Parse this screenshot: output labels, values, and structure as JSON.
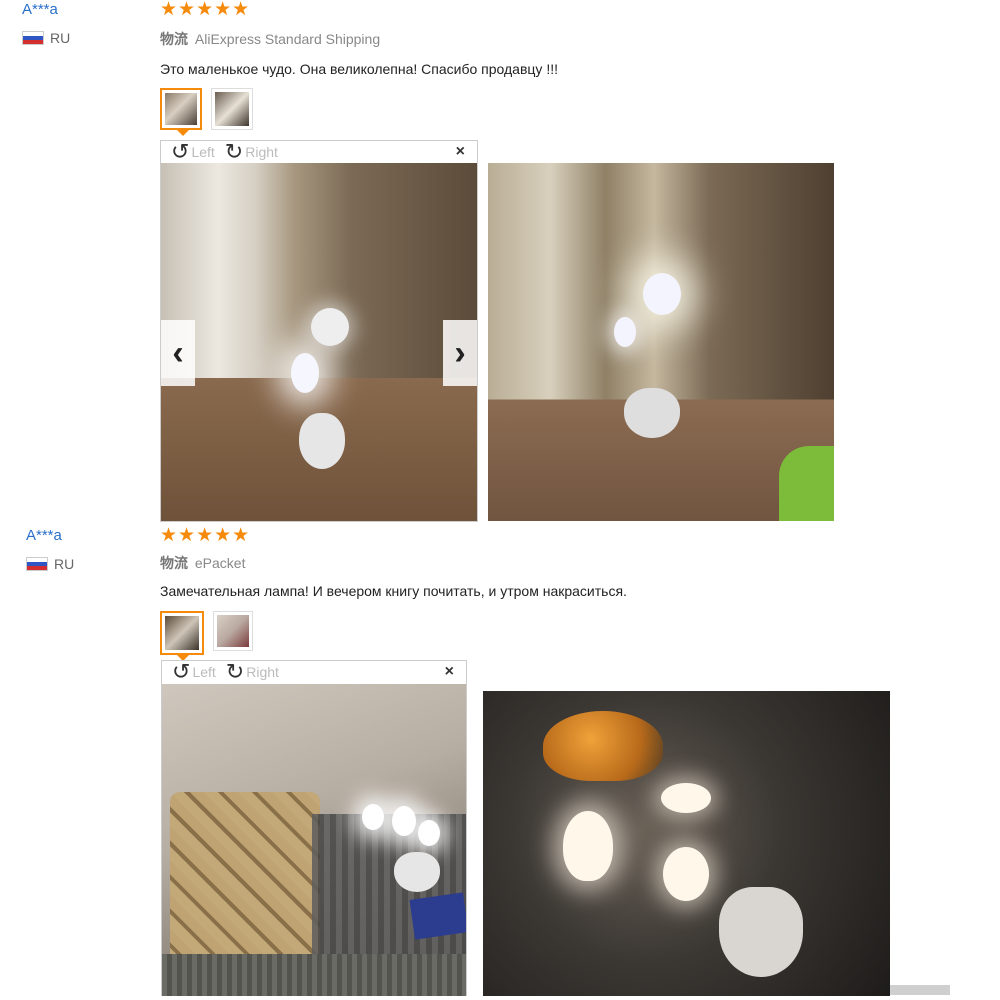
{
  "reviews": [
    {
      "user": "A***a",
      "country": "RU",
      "stars": "★★★★★",
      "shipping_label": "物流",
      "shipping": "AliExpress Standard Shipping",
      "text": "Это маленькое чудо. Она великолепна! Спасибо продавцу !!!"
    },
    {
      "user": "A***a",
      "country": "RU",
      "stars": "★★★★★",
      "shipping_label": "物流",
      "shipping": "ePacket",
      "text": "Замечательная лампа! И вечером книгу почитать, и утром накраситься."
    }
  ],
  "viewer": {
    "left_label": "Left",
    "right_label": "Right",
    "close": "×",
    "prev": "‹",
    "next": "›"
  },
  "icons": {
    "rotate_left": "rotate-left-icon",
    "rotate_right": "rotate-right-icon",
    "star": "star-icon",
    "flag": "flag-ru-icon"
  },
  "colors": {
    "accent": "#f58a0b",
    "user_link": "#2a6fc9"
  }
}
